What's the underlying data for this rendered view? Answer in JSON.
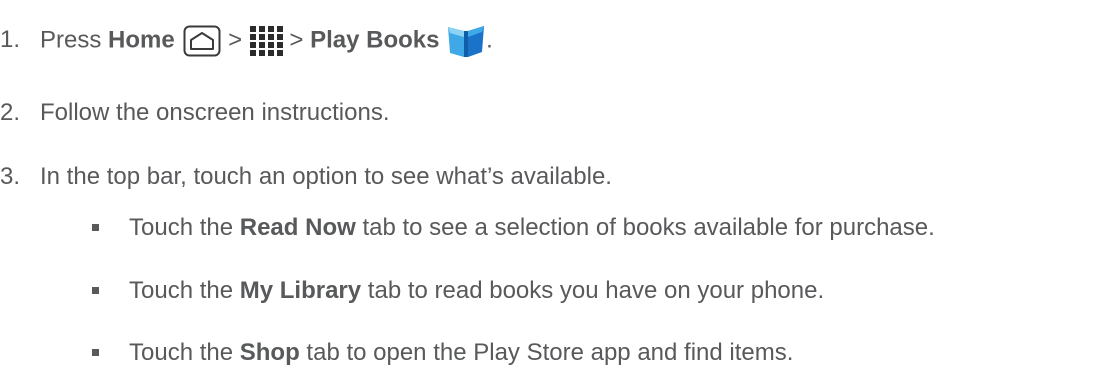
{
  "steps": [
    {
      "number": "1.",
      "press": "Press",
      "home": "Home",
      "sep1": ">",
      "sep2": ">",
      "app": "Play Books",
      "period": "."
    },
    {
      "number": "2.",
      "text": "Follow the onscreen instructions."
    },
    {
      "number": "3.",
      "text": "In the top bar, touch an option to see what’s available."
    }
  ],
  "bullets": [
    {
      "pre": "Touch the",
      "bold": "Read Now",
      "post": "tab to see a selection of books available for purchase."
    },
    {
      "pre": "Touch the",
      "bold": "My Library",
      "post": "tab to read books you have on your phone."
    },
    {
      "pre": "Touch the",
      "bold": "Shop",
      "post": "tab to open the Play Store app and find items."
    }
  ],
  "icons": {
    "home": "home-key-icon",
    "apps": "all-apps-grid-icon",
    "play_books": "play-books-app-icon"
  },
  "colors": {
    "text": "#58595b",
    "play_books_light": "#8fd3f4",
    "play_books_mid": "#3fa9e8",
    "play_books_dark": "#1a73c9"
  }
}
